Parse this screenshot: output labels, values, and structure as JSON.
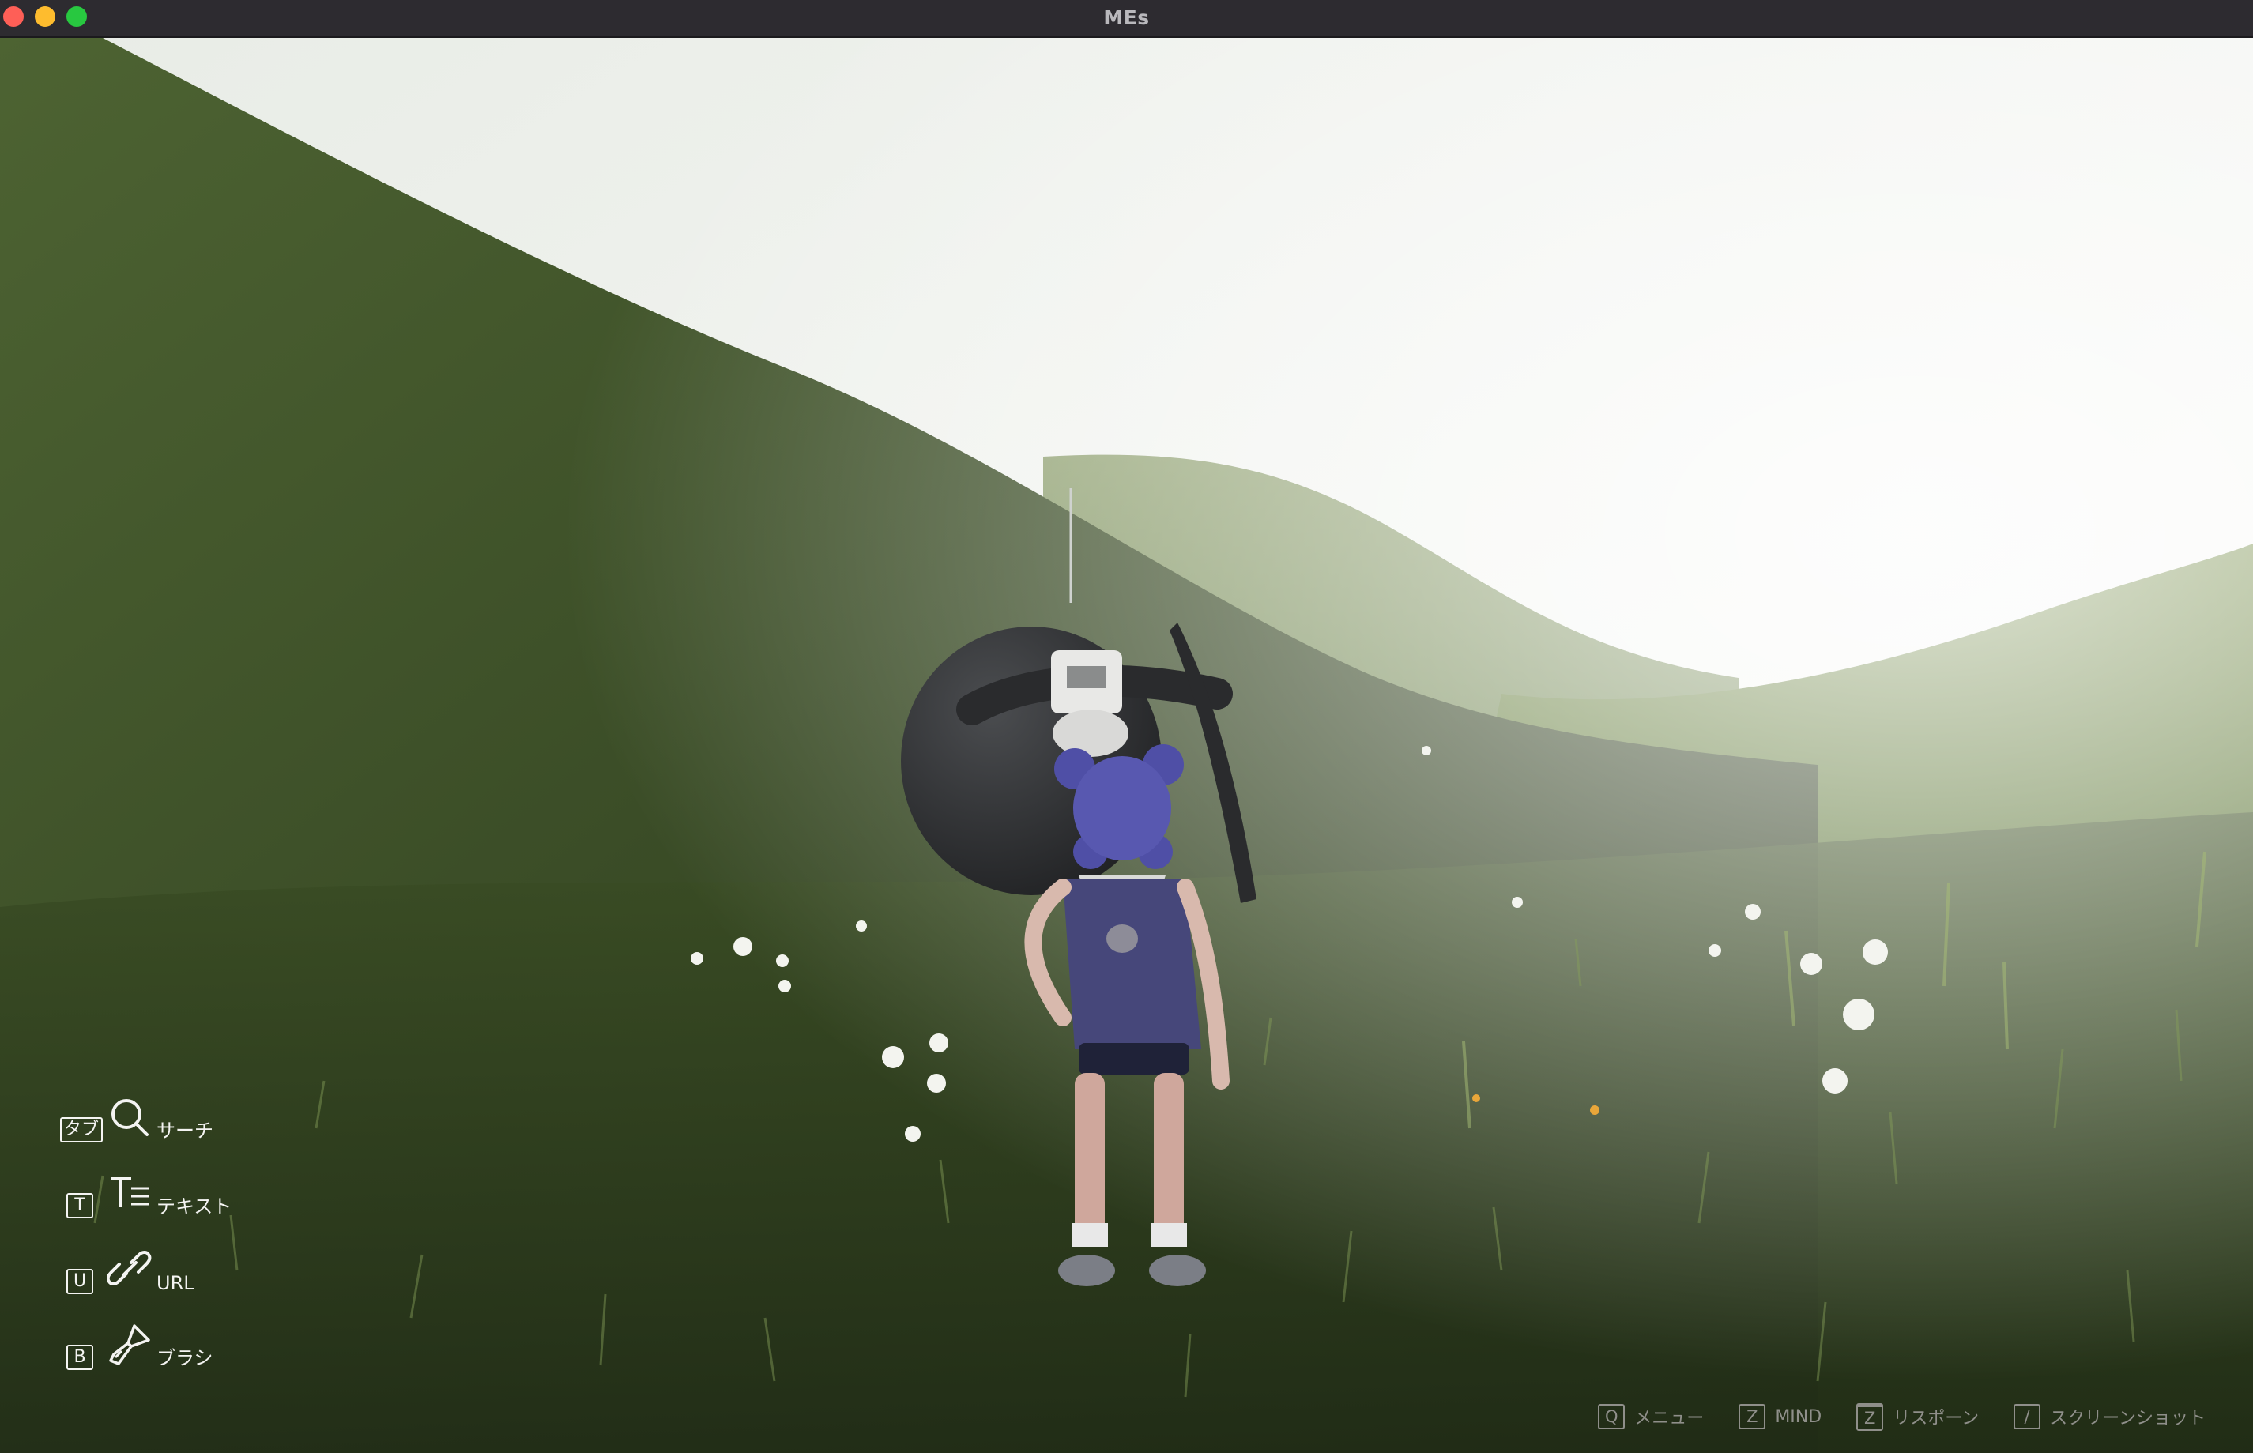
{
  "window": {
    "title": "MEs"
  },
  "hud_left": [
    {
      "key": "タブ",
      "icon": "search-icon",
      "label": "サーチ"
    },
    {
      "key": "T",
      "icon": "text-icon",
      "label": "テキスト"
    },
    {
      "key": "U",
      "icon": "link-icon",
      "label": "URL"
    },
    {
      "key": "B",
      "icon": "brush-icon",
      "label": "ブラシ"
    }
  ],
  "hud_bottom": [
    {
      "key": "Q",
      "label": "メニュー"
    },
    {
      "key": "Z",
      "label": "MIND"
    },
    {
      "key": "Z",
      "label": "リスポーン"
    },
    {
      "key": "/",
      "label": "スクリーンショット"
    }
  ],
  "colors": {
    "sky": "#f3f5f1",
    "grass_dark": "#2c3a20",
    "grass_light": "#6d8a45",
    "hud_text": "#f4f4f2",
    "hud_dim": "#8f8f8a"
  }
}
